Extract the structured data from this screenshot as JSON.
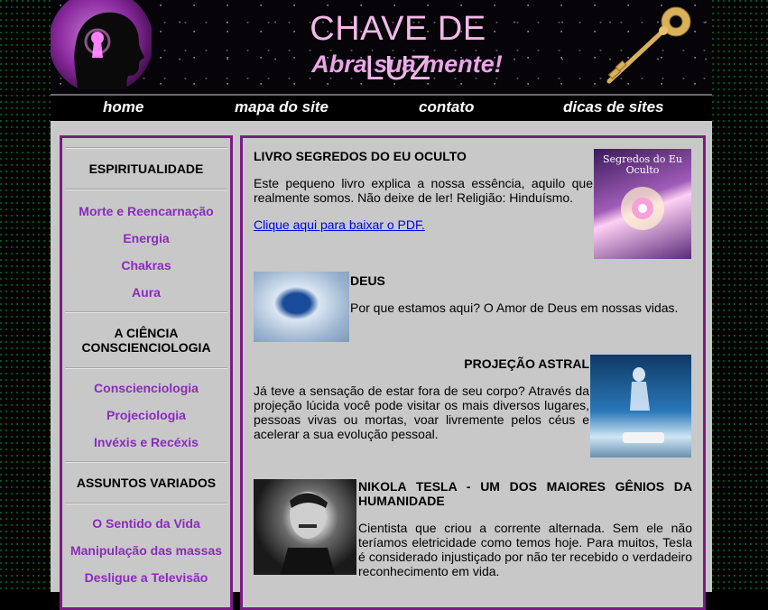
{
  "header": {
    "title": "CHAVE DE LUZ",
    "subtitle": "Abra sua mente!"
  },
  "nav": {
    "items": [
      "home",
      "mapa do site",
      "contato",
      "dicas de sites"
    ]
  },
  "sidebar": {
    "sections": [
      {
        "heading": "ESPIRITUALIDADE",
        "links": [
          "Morte e Reencarnação",
          "Energia",
          "Chakras",
          "Aura"
        ]
      },
      {
        "heading": "A CIÊNCIA CONSCIENCIOLOGIA",
        "links": [
          "Conscienciologia",
          "Projeciologia",
          "Invéxis e Recéxis"
        ]
      },
      {
        "heading": "ASSUNTOS VARIADOS",
        "links": [
          "O Sentido da Vida",
          "Manipulação das massas",
          "Desligue a Televisão"
        ]
      }
    ]
  },
  "articles": [
    {
      "title": "LIVRO SEGREDOS DO EU OCULTO",
      "text": "Este pequeno livro explica a nossa essência, aquilo que realmente somos. Não deixe de ler! Religião: Hinduísmo.",
      "link": "Clique aqui para baixar o PDF.",
      "book_cover_title": "Segredos do Eu Oculto"
    },
    {
      "title": "DEUS",
      "text": "Por que estamos aqui? O Amor de Deus em nossas vidas."
    },
    {
      "title": "PROJEÇÃO ASTRAL",
      "text": "Já teve a sensação de estar fora de seu corpo? Através da projeção lúcida você pode visitar os mais diversos lugares, pessoas vivas ou mortas, voar livremente pelos céus e acelerar a sua evolução pessoal."
    },
    {
      "title": "NIKOLA TESLA - UM DOS MAIORES GÊNIOS DA HUMANIDADE",
      "text": "Cientista que criou a corrente alternada. Sem ele não teríamos eletricidade como temos hoje. Para muitos, Tesla é considerado injustiçado por não ter recebido o verdadeiro reconhecimento em vida."
    }
  ],
  "colors": {
    "accent_purple": "#7d1a86",
    "link_purple": "#8a2bbb",
    "panel_gray": "#c8c8c8",
    "title_pink": "#f2b8e8"
  }
}
